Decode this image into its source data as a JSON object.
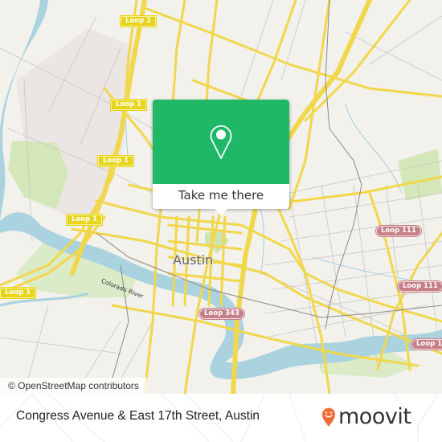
{
  "map": {
    "city_label": "Austin",
    "river_label": "Colorado River",
    "attribution": "© OpenStreetMap contributors",
    "route_shields": [
      {
        "label": "Loop 1",
        "style": "yellow"
      },
      {
        "label": "Loop 1",
        "style": "yellow"
      },
      {
        "label": "Loop 1",
        "style": "yellow"
      },
      {
        "label": "Loop 1",
        "style": "yellow"
      },
      {
        "label": "Loop 1",
        "style": "yellow"
      },
      {
        "label": "Loop 111",
        "style": "red"
      },
      {
        "label": "Loop 111",
        "style": "red"
      },
      {
        "label": "Loop 1",
        "style": "red"
      },
      {
        "label": "Loop 343",
        "style": "red"
      }
    ],
    "colors": {
      "land": "#f2f1ec",
      "water": "#aad3df",
      "park": "#d4e7b8",
      "major_road": "#f7e26b",
      "minor_road": "#c8c6c0",
      "rail": "#8a8a8a"
    }
  },
  "popup": {
    "icon": "map-pin-icon",
    "button_label": "Take me there",
    "accent": "#1fb867"
  },
  "footer": {
    "location_title": "Congress Avenue & East 17th Street, Austin",
    "brand": "moovit",
    "brand_icon": "moovit-smile-pin-icon",
    "brand_color": "#f26b3a"
  }
}
